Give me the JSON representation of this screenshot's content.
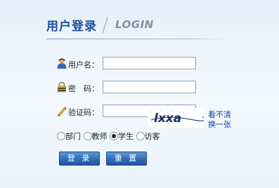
{
  "header": {
    "title_cn": "用户登录",
    "title_en": "LOGIN"
  },
  "form": {
    "username_label": "用户名：",
    "username_value": "",
    "password_label": "密　码：",
    "password_value": "",
    "captcha_label": "验证码：",
    "captcha_value": "",
    "captcha_image_text": "lxxa",
    "refresh_line1": "看不清",
    "refresh_line2": "换一张"
  },
  "roles": [
    {
      "label": "部门",
      "checked": false
    },
    {
      "label": "教师",
      "checked": false
    },
    {
      "label": "学生",
      "checked": true
    },
    {
      "label": "访客",
      "checked": false
    }
  ],
  "buttons": {
    "login": "登 录",
    "reset": "重 置"
  },
  "icons": {
    "username": "user-icon",
    "password": "lock-icon",
    "captcha": "pencil-icon"
  }
}
